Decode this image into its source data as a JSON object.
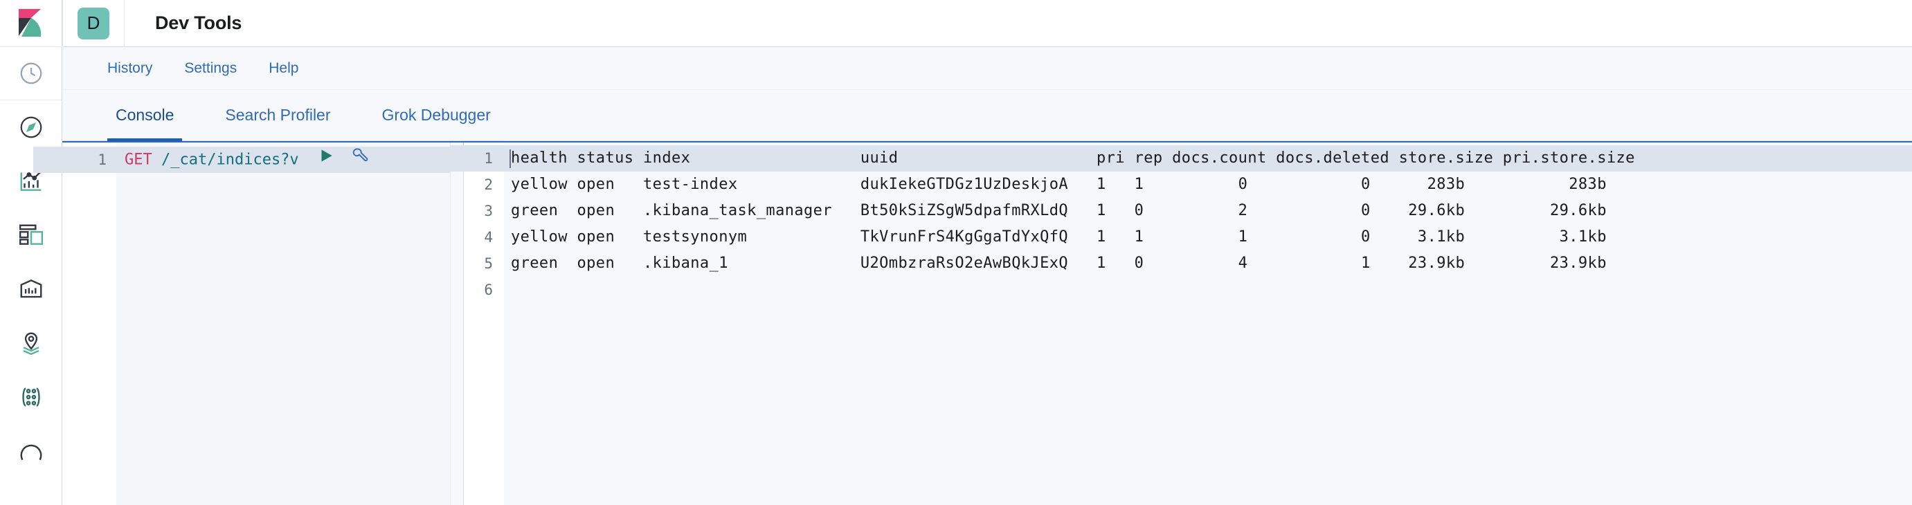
{
  "header": {
    "app_badge_letter": "D",
    "title": "Dev Tools",
    "logo_icon": "kibana-logo-icon"
  },
  "rail": {
    "items": [
      {
        "icon": "clock-recent-icon",
        "name": "recently-viewed"
      },
      {
        "icon": "compass-discover-icon",
        "name": "discover"
      },
      {
        "icon": "bar-chart-visualize-icon",
        "name": "visualize"
      },
      {
        "icon": "dashboard-grid-icon",
        "name": "dashboard"
      },
      {
        "icon": "canvas-icon",
        "name": "canvas"
      },
      {
        "icon": "map-pin-layers-icon",
        "name": "maps"
      },
      {
        "icon": "machine-learning-dots-icon",
        "name": "machine-learning"
      },
      {
        "icon": "partial-circle-icon",
        "name": "infrastructure"
      }
    ]
  },
  "navlinks": [
    {
      "label": "History",
      "name": "history"
    },
    {
      "label": "Settings",
      "name": "settings"
    },
    {
      "label": "Help",
      "name": "help"
    }
  ],
  "tabs": [
    {
      "label": "Console",
      "name": "console",
      "active": true
    },
    {
      "label": "Search Profiler",
      "name": "search-profiler",
      "active": false
    },
    {
      "label": "Grok Debugger",
      "name": "grok-debugger",
      "active": false
    }
  ],
  "editor": {
    "line_numbers": [
      "1"
    ],
    "request": {
      "method": "GET",
      "path": "/_cat/indices?v"
    },
    "play_icon": "play-triangle-icon",
    "wrench_icon": "wrench-icon"
  },
  "output": {
    "line_numbers": [
      "1",
      "2",
      "3",
      "4",
      "5",
      "6"
    ],
    "columns": [
      "health",
      "status",
      "index",
      "uuid",
      "pri",
      "rep",
      "docs.count",
      "docs.deleted",
      "store.size",
      "pri.store.size"
    ],
    "header_text": "health status index                  uuid                     pri rep docs.count docs.deleted store.size pri.store.size",
    "rows": [
      {
        "health": "yellow",
        "status": "open",
        "index": "test-index",
        "uuid": "dukIekeGTDGz1UzDeskjoA",
        "pri": "1",
        "rep": "1",
        "docs_count": "0",
        "docs_deleted": "0",
        "store_size": "283b",
        "pri_store_size": "283b",
        "text": "yellow open   test-index             dukIekeGTDGz1UzDeskjoA   1   1          0            0      283b           283b"
      },
      {
        "health": "green",
        "status": "open",
        "index": ".kibana_task_manager",
        "uuid": "Bt50kSiZSgW5dpafmRXLdQ",
        "pri": "1",
        "rep": "0",
        "docs_count": "2",
        "docs_deleted": "0",
        "store_size": "29.6kb",
        "pri_store_size": "29.6kb",
        "text": "green  open   .kibana_task_manager   Bt50kSiZSgW5dpafmRXLdQ   1   0          2            0    29.6kb         29.6kb"
      },
      {
        "health": "yellow",
        "status": "open",
        "index": "testsynonym",
        "uuid": "TkVrunFrS4KgGgaTdYxQfQ",
        "pri": "1",
        "rep": "1",
        "docs_count": "1",
        "docs_deleted": "0",
        "store_size": "3.1kb",
        "pri_store_size": "3.1kb",
        "text": "yellow open   testsynonym            TkVrunFrS4KgGgaTdYxQfQ   1   1          1            0     3.1kb          3.1kb"
      },
      {
        "health": "green",
        "status": "open",
        "index": ".kibana_1",
        "uuid": "U2OmbzraRsO2eAwBQkJExQ",
        "pri": "1",
        "rep": "0",
        "docs_count": "4",
        "docs_deleted": "1",
        "store_size": "23.9kb",
        "pri_store_size": "23.9kb",
        "text": "green  open   .kibana_1              U2OmbzraRsO2eAwBQkJExQ   1   0          4            1    23.9kb         23.9kb"
      },
      {
        "text": ""
      }
    ]
  },
  "colors": {
    "link_blue": "#2f6bb4",
    "accent_teal": "#6fc2b5",
    "method_pink": "#d1386a",
    "url_teal": "#10707f",
    "play_green": "#207b6c",
    "active_line": "#dde3ed"
  }
}
